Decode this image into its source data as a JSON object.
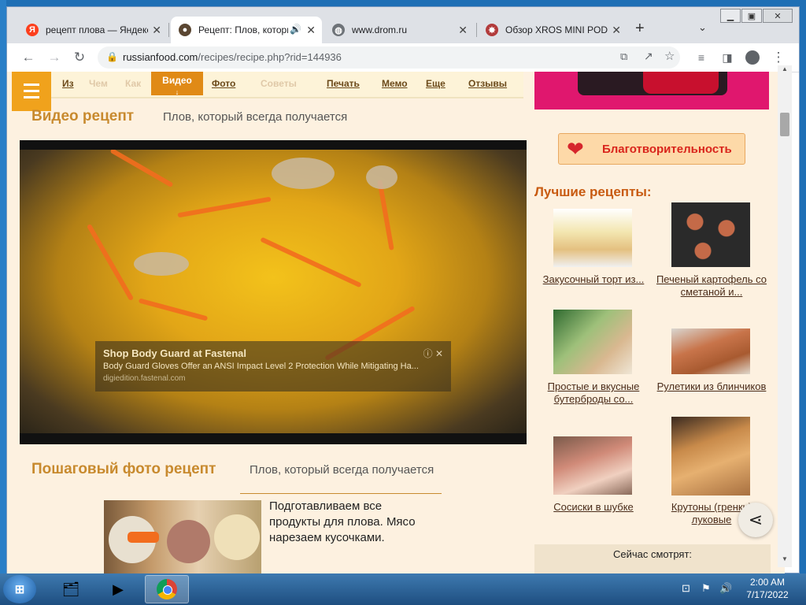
{
  "browser": {
    "tabs": [
      {
        "title": "рецепт плова — Яндекс",
        "fav": "Я",
        "favColor": "#fc3f1d"
      },
      {
        "title": "Рецепт: Плов, который всегда",
        "fav": "●",
        "favColor": "#5a4632"
      },
      {
        "title": "www.drom.ru",
        "fav": "◍",
        "favColor": "#6e7378"
      },
      {
        "title": "Обзор XROS MINI POD",
        "fav": "✸",
        "favColor": "#b23b3b"
      }
    ],
    "url_host": "russianfood.com",
    "url_path": "/recipes/recipe.php?rid=144936"
  },
  "nav": {
    "items": [
      "Из",
      "Чем",
      "Как",
      "Видео",
      "Фото",
      "Советы",
      "Печать",
      "Мемо",
      "Еще",
      "Отзывы"
    ]
  },
  "video_section": {
    "heading": "Видео рецепт",
    "subtitle": "Плов, который всегда получается"
  },
  "ad": {
    "title": "Shop Body Guard at Fastenal",
    "text": "Body Guard Gloves Offer an ANSI Impact Level 2 Protection While Mitigating Ha...",
    "domain": "digiedition.fastenal.com"
  },
  "photo_section": {
    "heading": "Пошаговый фото рецепт",
    "subtitle": "Плов, который всегда получается",
    "step_text": "Подготавливаем все продукты для плова. Мясо нарезаем кусочками."
  },
  "sidebar": {
    "charity": "Благотворительность",
    "best_heading": "Лучшие рецепты:",
    "recipes": [
      {
        "title": "Закусочный торт из..."
      },
      {
        "title": "Печеный картофель со сметаной и..."
      },
      {
        "title": "Простые и вкусные бутерброды со..."
      },
      {
        "title": "Рулетики из блинчиков"
      },
      {
        "title": "Сосиски в шубке"
      },
      {
        "title": "Крутоны (гренки) луковые"
      }
    ],
    "now_watching": "Сейчас смотрят:"
  },
  "taskbar": {
    "time": "2:00 AM",
    "date": "7/17/2022"
  }
}
